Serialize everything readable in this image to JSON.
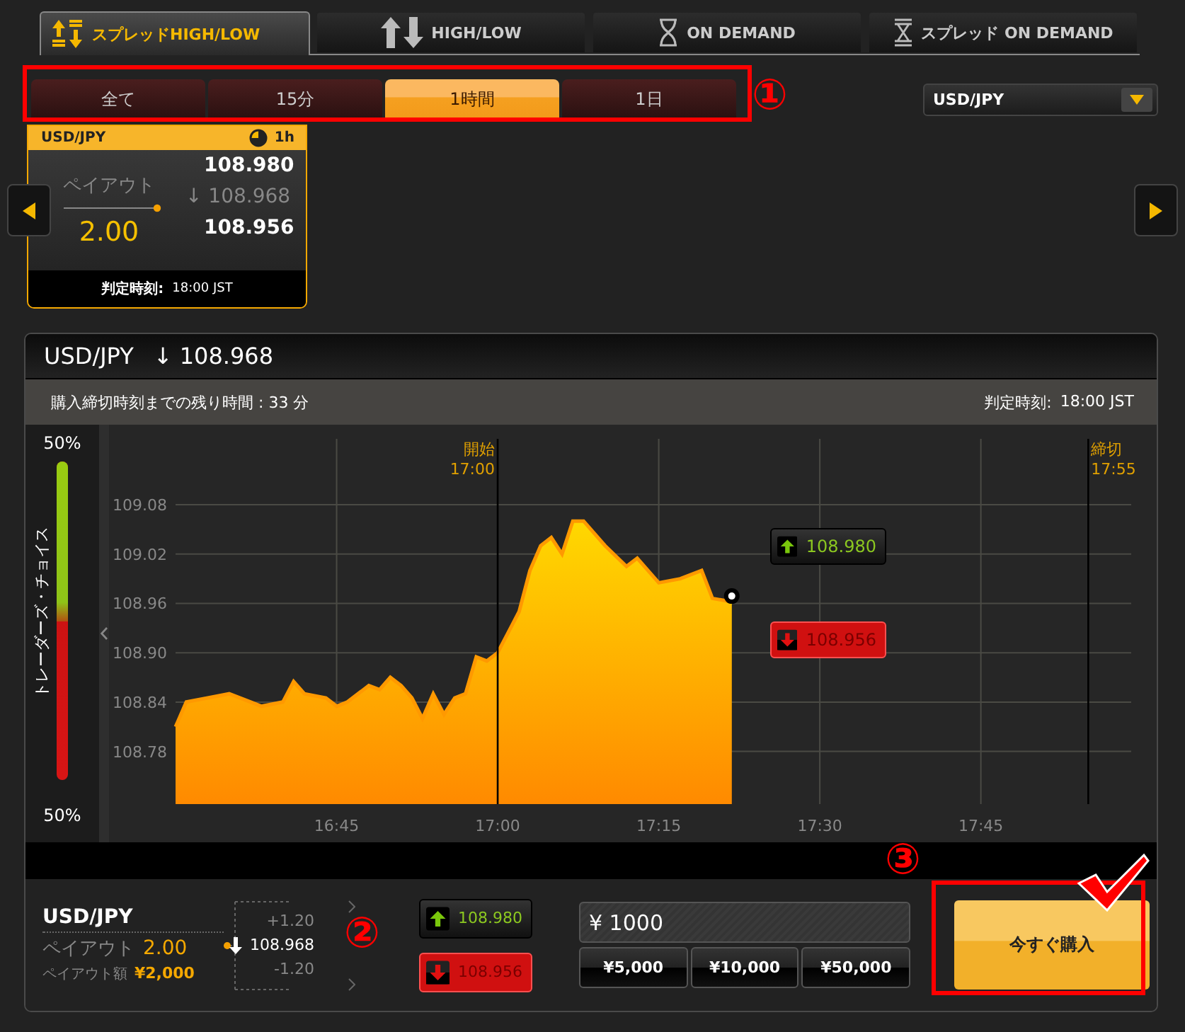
{
  "product_tabs": [
    {
      "kind": "spread_highlow",
      "label": "スプレッドHIGH/LOW",
      "selected": true
    },
    {
      "kind": "highlow",
      "label": "HIGH/LOW",
      "selected": false
    },
    {
      "kind": "ondemand",
      "label": "ON DEMAND",
      "selected": false
    },
    {
      "kind": "spread_ondemand",
      "label": "スプレッド ON DEMAND",
      "selected": false
    }
  ],
  "period_tabs": [
    {
      "label": "全て",
      "selected": false
    },
    {
      "label": "15分",
      "selected": false
    },
    {
      "label": "1時間",
      "selected": true
    },
    {
      "label": "1日",
      "selected": false
    }
  ],
  "pair_select": {
    "value": "USD/JPY"
  },
  "option_card": {
    "pair": "USD/JPY",
    "duration": "1h",
    "payout_label": "ペイアウト",
    "payout": "2.00",
    "high": "108.980",
    "current": "↓ 108.968",
    "low": "108.956",
    "expiry_label": "判定時刻:",
    "expiry": "18:00 JST"
  },
  "chart_panel": {
    "pair": "USD/JPY",
    "price": "↓ 108.968",
    "remaining": "購入締切時刻までの残り時間 : 33 分",
    "expiry_label": "判定時刻:",
    "expiry": "18:00 JST",
    "traders_choice": {
      "label": "トレーダーズ・チョイス",
      "high_pct": "50%",
      "low_pct": "50%",
      "level": 0.5
    },
    "price_tags": [
      {
        "kind": "high",
        "value": "108.980",
        "selected": false
      },
      {
        "kind": "low",
        "value": "108.956",
        "selected": true
      }
    ],
    "chart_data": {
      "type": "area",
      "xlim": [
        990,
        1079
      ],
      "ylim": [
        108.716,
        109.16
      ],
      "xticks": [
        {
          "value": 1005,
          "label": "16:45"
        },
        {
          "value": 1020,
          "label": "17:00"
        },
        {
          "value": 1035,
          "label": "17:15"
        },
        {
          "value": 1050,
          "label": "17:30"
        },
        {
          "value": 1065,
          "label": "17:45"
        }
      ],
      "grid": true,
      "yticks": [
        {
          "value": 108.78,
          "label": "108.78"
        },
        {
          "value": 108.84,
          "label": "108.84"
        },
        {
          "value": 108.9,
          "label": "108.90"
        },
        {
          "value": 108.96,
          "label": "108.96"
        },
        {
          "value": 109.02,
          "label": "109.02"
        },
        {
          "value": 109.08,
          "label": "109.08"
        }
      ],
      "x": [
        990,
        991,
        993,
        995,
        997,
        998,
        1000,
        1001,
        1002,
        1004,
        1005,
        1006,
        1008,
        1009,
        1010,
        1011,
        1012,
        1013,
        1014,
        1015,
        1016,
        1017,
        1018,
        1019,
        1020,
        1021,
        1022,
        1023,
        1024,
        1025,
        1026,
        1027,
        1028,
        1030,
        1032,
        1033,
        1035,
        1037,
        1039,
        1040,
        1041.8
      ],
      "series": [
        {
          "color": "#ff9900",
          "values": [
            108.81,
            108.84,
            108.845,
            108.85,
            108.84,
            108.835,
            108.84,
            108.865,
            108.85,
            108.845,
            108.835,
            108.84,
            108.86,
            108.855,
            108.87,
            108.86,
            108.845,
            108.82,
            108.85,
            108.825,
            108.845,
            108.85,
            108.895,
            108.89,
            108.9,
            108.925,
            108.95,
            109.0,
            109.03,
            109.04,
            109.02,
            109.06,
            109.06,
            109.03,
            109.005,
            109.015,
            108.985,
            108.99,
            109.0,
            108.966,
            108.962
          ]
        }
      ],
      "ref_lines": [
        {
          "axis": "x",
          "value": 1020,
          "label": "開始"
        },
        {
          "axis": "x",
          "value": 1075,
          "label": "締切"
        }
      ],
      "annotations": [
        "17:00",
        "17:55"
      ]
    }
  },
  "trade_panel": {
    "pair": "USD/JPY",
    "payout_label": "ペイアウト",
    "payout": "2.00",
    "amount_label": "ペイアウト額",
    "amount": "¥2,000",
    "upper": "+1.20",
    "current": "108.968",
    "lower": "-1.20",
    "buttons": [
      {
        "kind": "high",
        "value": "108.980",
        "selected": false
      },
      {
        "kind": "low",
        "value": "108.956",
        "selected": true
      }
    ],
    "investment": "¥ 1000",
    "presets": [
      "¥5,000",
      "¥10,000",
      "¥50,000"
    ],
    "buy_button": "今すぐ購入"
  },
  "callouts": [
    {
      "number": "①"
    },
    {
      "number": "②"
    },
    {
      "number": "③"
    }
  ]
}
